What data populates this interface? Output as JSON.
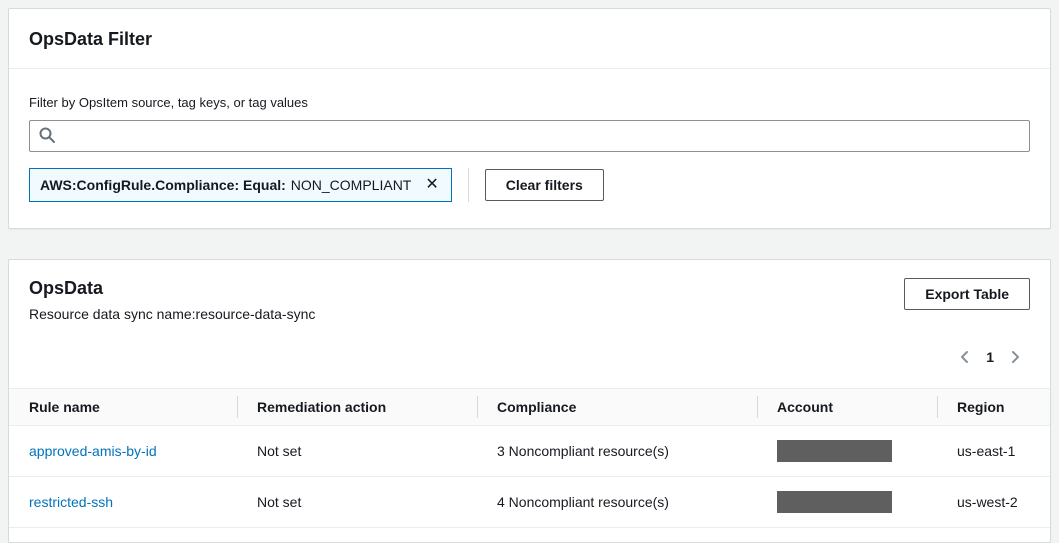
{
  "colors": {
    "page_background": "#f2f3f3",
    "card_background": "#ffffff",
    "border": "#eaeded",
    "text": "#16191f",
    "link": "#0073bb",
    "chip_border": "#0073bb",
    "chip_background": "#f1faff",
    "button_border": "#545b64",
    "redacted_box": "#5f5f5f"
  },
  "icons": {
    "search": "magnifier",
    "chip_close": "✕",
    "pagination_prev": "chevron-left",
    "pagination_next": "chevron-right"
  },
  "filter_card": {
    "title": "OpsData Filter",
    "filter_label": "Filter by OpsItem source, tag keys, or tag values",
    "search": {
      "placeholder": ""
    },
    "chip": {
      "label": "AWS:ConfigRule.Compliance: Equal:",
      "value": "NON_COMPLIANT"
    },
    "clear_button_label": "Clear filters"
  },
  "opsdata_card": {
    "title": "OpsData",
    "subtitle": "Resource data sync name:resource-data-sync",
    "export_button_label": "Export Table",
    "pagination": {
      "current_page": "1"
    },
    "table": {
      "columns": [
        "Rule name",
        "Remediation action",
        "Compliance",
        "Account",
        "Region"
      ],
      "rows": [
        {
          "rule_name": "approved-amis-by-id",
          "remediation_action": "Not set",
          "compliance": "3 Noncompliant resource(s)",
          "account_redacted": true,
          "region": "us-east-1"
        },
        {
          "rule_name": "restricted-ssh",
          "remediation_action": "Not set",
          "compliance": "4 Noncompliant resource(s)",
          "account_redacted": true,
          "region": "us-west-2"
        }
      ]
    }
  }
}
